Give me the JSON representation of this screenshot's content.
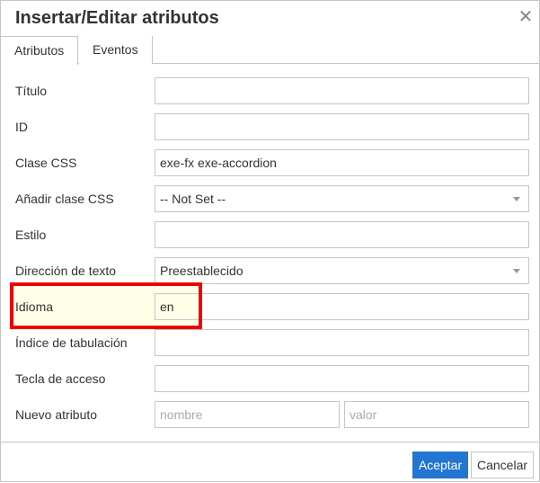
{
  "dialog": {
    "title": "Insertar/Editar atributos"
  },
  "tabs": [
    {
      "label": "Atributos",
      "active": true
    },
    {
      "label": "Eventos",
      "active": false
    }
  ],
  "fields": {
    "titulo": {
      "label": "Título",
      "value": ""
    },
    "id": {
      "label": "ID",
      "value": ""
    },
    "clase_css": {
      "label": "Clase CSS",
      "value": "exe-fx exe-accordion"
    },
    "anadir_clase": {
      "label": "Añadir clase CSS",
      "value": "-- Not Set --"
    },
    "estilo": {
      "label": "Estilo",
      "value": ""
    },
    "direccion": {
      "label": "Dirección de texto",
      "value": "Preestablecido"
    },
    "idioma": {
      "label": "Idioma",
      "value": "en"
    },
    "indice": {
      "label": "Índice de tabulación",
      "value": ""
    },
    "tecla": {
      "label": "Tecla de acceso",
      "value": ""
    },
    "nuevo": {
      "label": "Nuevo atributo",
      "name_placeholder": "nombre",
      "value_placeholder": "valor"
    }
  },
  "buttons": {
    "accept": "Aceptar",
    "cancel": "Cancelar"
  },
  "icons": {
    "close": "close-icon",
    "dropdown": "chevron-down-icon"
  },
  "colors": {
    "accent": "#2276d2",
    "highlight_border": "#ee0000",
    "highlight_fill": "#ffffe8"
  }
}
